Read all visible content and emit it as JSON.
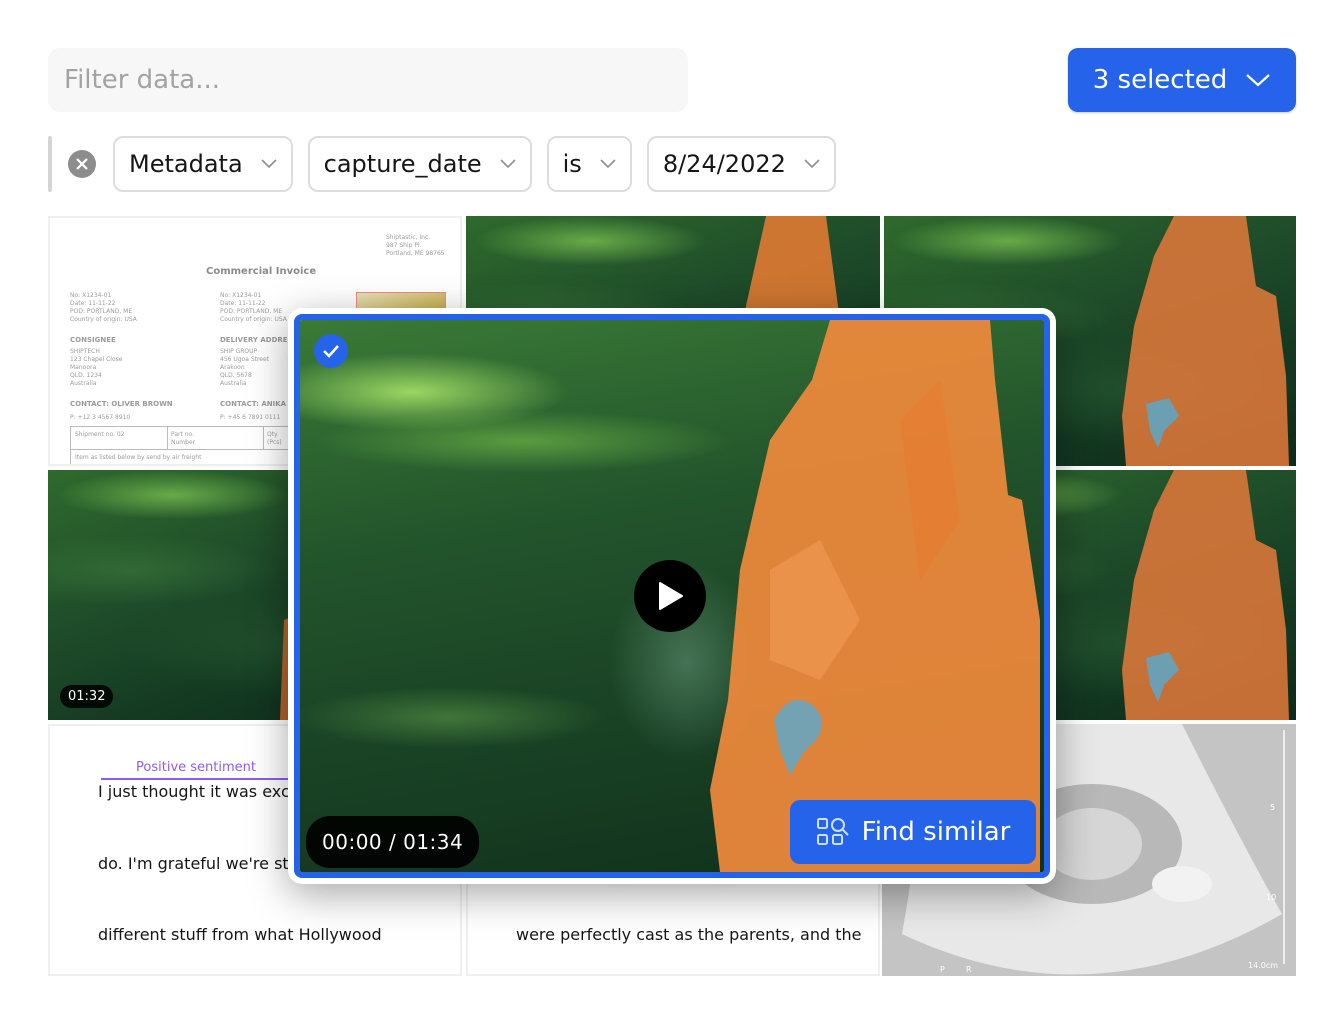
{
  "search": {
    "placeholder": "Filter data...",
    "value": ""
  },
  "selection": {
    "label": "3 selected",
    "count": 3
  },
  "filter": {
    "source": "Metadata",
    "field": "capture_date",
    "operator": "is",
    "value": "8/24/2022"
  },
  "colors": {
    "accent": "#2563eb",
    "sentiment": "#8b5cf6",
    "mask_orange": "#f07c30",
    "mask_blue": "#6fa3b8"
  },
  "tiles": {
    "invoice": {
      "company": "Shiptastic, Inc.\n987 Ship Pl.\nPortland, ME 98765",
      "title": "Commercial Invoice",
      "left_meta": "No: X1234-01\nDate: 11-11-22\nPOD: PORTLAND, ME\nCountry of origin: USA",
      "right_meta": "No: X1234-01\nDate: 11-11-22\nPOD: PORTLAND, ME\nCountry of origin: USA",
      "consignee_heading": "CONSIGNEE",
      "consignee": "SHIPTECH\n123 Chapel Close\nManoora\nQLD, 1234\nAustralia",
      "delivery_heading": "DELIVERY ADDRESS",
      "delivery": "SHIP GROUP\n456 Ugoa Street\nArakoon\nQLD, 5678\nAustralia",
      "contact_left": "CONTACT: OLIVER BROWN",
      "phone_left": "P: +12 3 4567 8910",
      "contact_right": "CONTACT: ANIKA L",
      "phone_right": "P: +45 6 7891 0111",
      "table_col1": "Shipment no. 02",
      "table_col2": "Part no.\nNumber",
      "table_col3": "Qty\n(Pcs)",
      "table_note": "Item as listed below by send by air freight"
    },
    "video_small": {
      "duration": "01:32"
    },
    "text1": {
      "sentiment_label": "Positive sentiment",
      "line1": "I just thought it was excell",
      "line2": "do. I'm grateful we're still",
      "line3": "different stuff from what Hollywood"
    },
    "text2": {
      "line3": "were perfectly cast as the parents, and the"
    },
    "ultrasound": {
      "scale_5": "5",
      "scale_10": "10",
      "depth": "14.0cm",
      "orient_p": "P",
      "orient_r": "R"
    }
  },
  "preview": {
    "selected": true,
    "timecode": "00:00 / 01:34",
    "find_similar_label": "Find similar"
  }
}
